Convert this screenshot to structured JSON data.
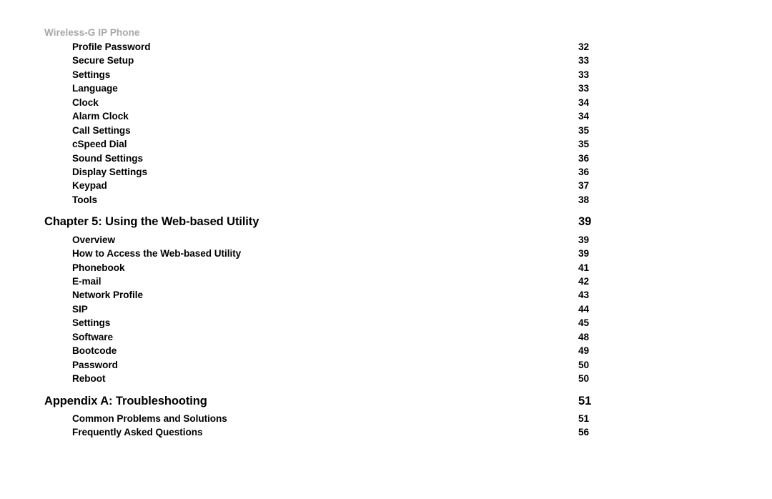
{
  "document": {
    "running_header": "Wireless-G IP Phone",
    "header_color": "#a7a7a7",
    "text_color": "#000000",
    "background_color": "#ffffff"
  },
  "toc": {
    "rows": [
      {
        "level": "entry",
        "label": "Profile Password",
        "page": "32"
      },
      {
        "level": "entry",
        "label": "Secure Setup",
        "page": "33"
      },
      {
        "level": "entry",
        "label": "Settings",
        "page": "33"
      },
      {
        "level": "entry",
        "label": "Language",
        "page": "33"
      },
      {
        "level": "entry",
        "label": "Clock",
        "page": "34"
      },
      {
        "level": "entry",
        "label": "Alarm Clock",
        "page": "34"
      },
      {
        "level": "entry",
        "label": "Call Settings",
        "page": "35"
      },
      {
        "level": "entry",
        "label": "cSpeed Dial",
        "page": "35"
      },
      {
        "level": "entry",
        "label": "Sound Settings",
        "page": "36"
      },
      {
        "level": "entry",
        "label": "Display Settings",
        "page": "36"
      },
      {
        "level": "entry",
        "label": "Keypad",
        "page": "37"
      },
      {
        "level": "entry",
        "label": "Tools",
        "page": "38"
      },
      {
        "level": "chapter",
        "label": "Chapter 5: Using the Web-based Utility",
        "page": "39"
      },
      {
        "level": "entry",
        "label": "Overview",
        "page": "39"
      },
      {
        "level": "entry",
        "label": "How to Access the Web-based Utility",
        "page": "39"
      },
      {
        "level": "entry",
        "label": "Phonebook",
        "page": "41"
      },
      {
        "level": "entry",
        "label": "E-mail",
        "page": "42"
      },
      {
        "level": "entry",
        "label": "Network Profile",
        "page": "43"
      },
      {
        "level": "entry",
        "label": "SIP",
        "page": "44"
      },
      {
        "level": "entry",
        "label": "Settings",
        "page": "45"
      },
      {
        "level": "entry",
        "label": "Software",
        "page": "48"
      },
      {
        "level": "entry",
        "label": "Bootcode",
        "page": "49"
      },
      {
        "level": "entry",
        "label": "Password",
        "page": "50"
      },
      {
        "level": "entry",
        "label": "Reboot",
        "page": "50"
      },
      {
        "level": "chapter",
        "label": "Appendix A: Troubleshooting",
        "page": "51"
      },
      {
        "level": "entry",
        "label": "Common Problems and Solutions",
        "page": "51"
      },
      {
        "level": "entry",
        "label": "Frequently Asked Questions",
        "page": "56"
      }
    ]
  }
}
